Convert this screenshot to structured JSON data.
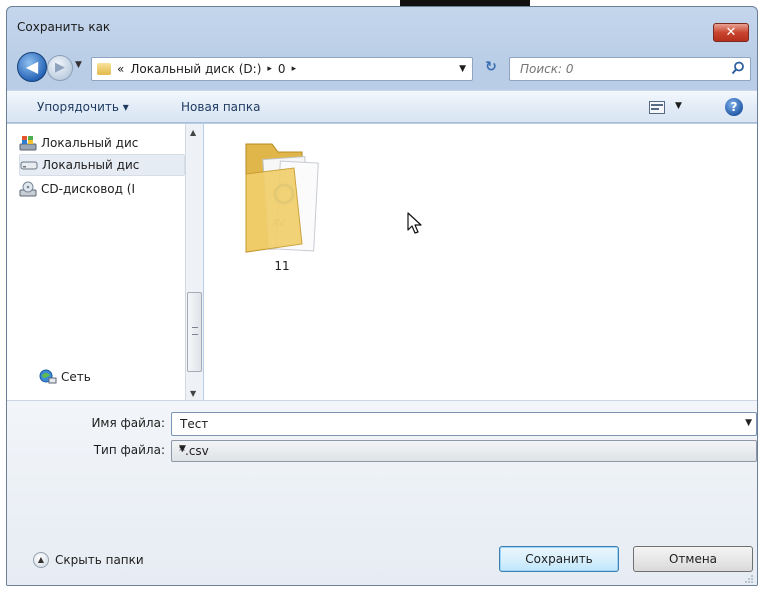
{
  "window": {
    "title": "Сохранить как",
    "close_glyph": "✕"
  },
  "nav": {
    "back_glyph": "◀",
    "forward_glyph": "▶",
    "history_glyph": "▼"
  },
  "address": {
    "prefix": "«",
    "crumbs": [
      "Локальный диск (D:)",
      "0"
    ],
    "separator": "▸",
    "dropdown_glyph": "▼",
    "refresh_glyph": "↻"
  },
  "search": {
    "placeholder": "Поиск: 0"
  },
  "toolbar": {
    "organize_label": "Упорядочить ▾",
    "new_folder_label": "Новая папка",
    "view_dropdown_glyph": "▼",
    "help_glyph": "?"
  },
  "sidebar": {
    "items": [
      {
        "label": "Локальный дис",
        "icon": "windows-drive-icon",
        "selected": false
      },
      {
        "label": "Локальный дис",
        "icon": "hard-drive-icon",
        "selected": true
      },
      {
        "label": "CD-дисковод (I",
        "icon": "cd-drive-icon",
        "selected": false
      }
    ],
    "network": {
      "label": "Сеть",
      "icon": "network-icon"
    },
    "scroll_up_glyph": "▲",
    "scroll_down_glyph": "▼"
  },
  "content": {
    "folders": [
      {
        "name": "11",
        "icon": "folder-icon"
      }
    ]
  },
  "form": {
    "filename_label": "Имя файла:",
    "filename_value": "Тест",
    "filetype_label": "Тип файла:",
    "filetype_value": "*.csv",
    "dropdown_glyph": "▼"
  },
  "footer": {
    "hide_folders_label": "Скрыть папки",
    "hide_folders_glyph": "▲",
    "save_label": "Сохранить",
    "cancel_label": "Отмена"
  },
  "colors": {
    "chrome": "#b9cde6",
    "close": "#c9452f",
    "accent": "#2866b8"
  }
}
